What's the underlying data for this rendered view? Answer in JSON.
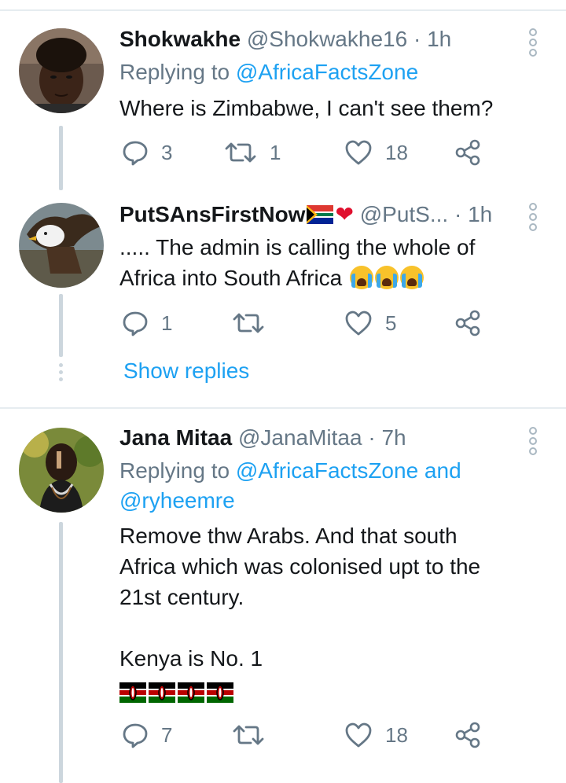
{
  "tweets": [
    {
      "name": "Shokwakhe",
      "handle": "@Shokwakhe16",
      "sep": "·",
      "time": "1h",
      "replying_prefix": "Replying to ",
      "replying_mentions": "@AfricaFactsZone",
      "text": "Where is Zimbabwe, I can't see them?",
      "replies": "3",
      "retweets": "1",
      "likes": "18"
    },
    {
      "name": "PutSAnsFirstNow",
      "handle": "@PutS...",
      "sep": "·",
      "time": "1h",
      "text_line1": "..... The admin is calling the whole of",
      "text_line2": "Africa into South Africa",
      "replies": "1",
      "retweets": "",
      "likes": "5",
      "show_replies": "Show replies"
    },
    {
      "name": "Jana Mitaa",
      "handle": "@JanaMitaa",
      "sep": "·",
      "time": "7h",
      "replying_prefix": "Replying to ",
      "replying_mentions_line1": "@AfricaFactsZone and",
      "replying_mentions_line2": "@ryheemre",
      "text_line1": "Remove thw Arabs. And that south",
      "text_line2": "Africa which was colonised upt to the",
      "text_line3": "21st century.",
      "text_line4": "Kenya is No. 1",
      "replies": "7",
      "retweets": "",
      "likes": "18"
    }
  ],
  "colors": {
    "link": "#1da1f2",
    "secondary_text": "#657786",
    "icon": "#657786",
    "thread_line": "#ccd6dd"
  },
  "icons": {
    "reply": "reply-icon",
    "retweet": "retweet-icon",
    "like": "heart-icon",
    "share": "share-icon",
    "more": "more-options-icon"
  }
}
